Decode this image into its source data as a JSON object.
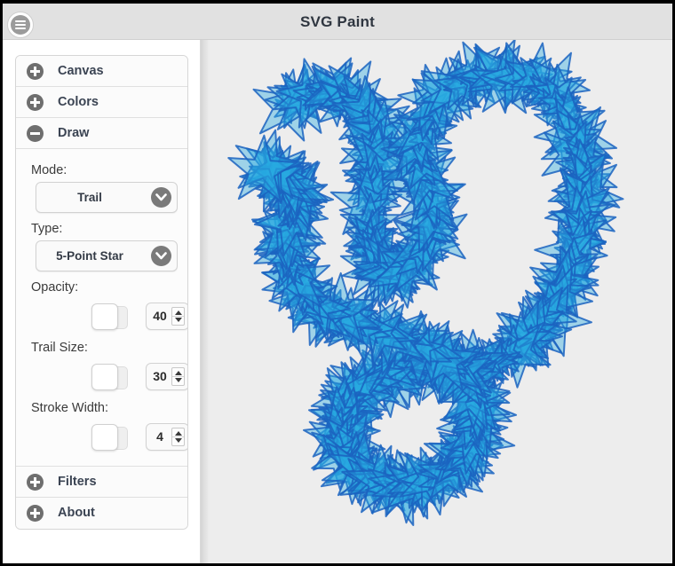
{
  "app": {
    "title": "SVG Paint",
    "menu_icon": "hamburger-menu-icon"
  },
  "sidebar": {
    "sections": [
      {
        "label": "Canvas",
        "icon": "plus-circle-icon",
        "expanded": false
      },
      {
        "label": "Colors",
        "icon": "plus-circle-icon",
        "expanded": false
      },
      {
        "label": "Draw",
        "icon": "minus-circle-icon",
        "expanded": true
      },
      {
        "label": "Filters",
        "icon": "plus-circle-icon",
        "expanded": false
      },
      {
        "label": "About",
        "icon": "plus-circle-icon",
        "expanded": false
      }
    ],
    "draw_panel": {
      "mode": {
        "label": "Mode:",
        "value": "Trail",
        "arrow_icon": "chevron-down-icon"
      },
      "type": {
        "label": "Type:",
        "value": "5-Point Star",
        "arrow_icon": "chevron-down-icon"
      },
      "opacity": {
        "label": "Opacity:",
        "value": "40",
        "slider_pct": 40
      },
      "trail_size": {
        "label": "Trail Size:",
        "value": "30",
        "slider_pct": 30
      },
      "stroke_width": {
        "label": "Stroke Width:",
        "value": "4",
        "slider_pct": 4
      }
    }
  },
  "canvas": {
    "background": "#ededed",
    "shape": "5-point-star",
    "fill": "#29ABE2",
    "stroke": "#1B63C0",
    "opacity": 0.4,
    "stroke_width": 2
  }
}
